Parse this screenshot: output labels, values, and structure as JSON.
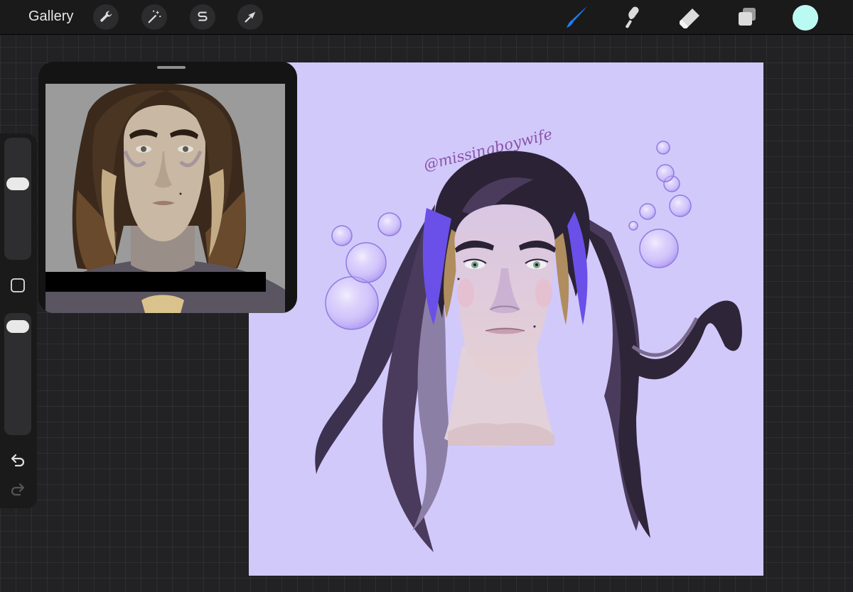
{
  "toolbar": {
    "gallery_label": "Gallery",
    "action_icons": [
      "wrench-icon",
      "magic-wand-icon",
      "selection-s-icon",
      "transform-arrow-icon"
    ],
    "tool_icons": [
      "brush-icon",
      "smudge-icon",
      "eraser-icon",
      "layers-icon"
    ],
    "active_tool": "brush",
    "active_color": "#b9fbf3",
    "brush_highlight_color": "#1f7cf2"
  },
  "sidebar": {
    "brush_size_level": 0.64,
    "opacity_level": 0.95,
    "icons": [
      "square-modify-icon",
      "undo-icon",
      "redo-icon"
    ]
  },
  "reference": {
    "background_color": "#9b9b9b",
    "redaction_color": "#000000"
  },
  "canvas": {
    "background_color": "#d2c9fb",
    "signature": "@missingboywife"
  }
}
